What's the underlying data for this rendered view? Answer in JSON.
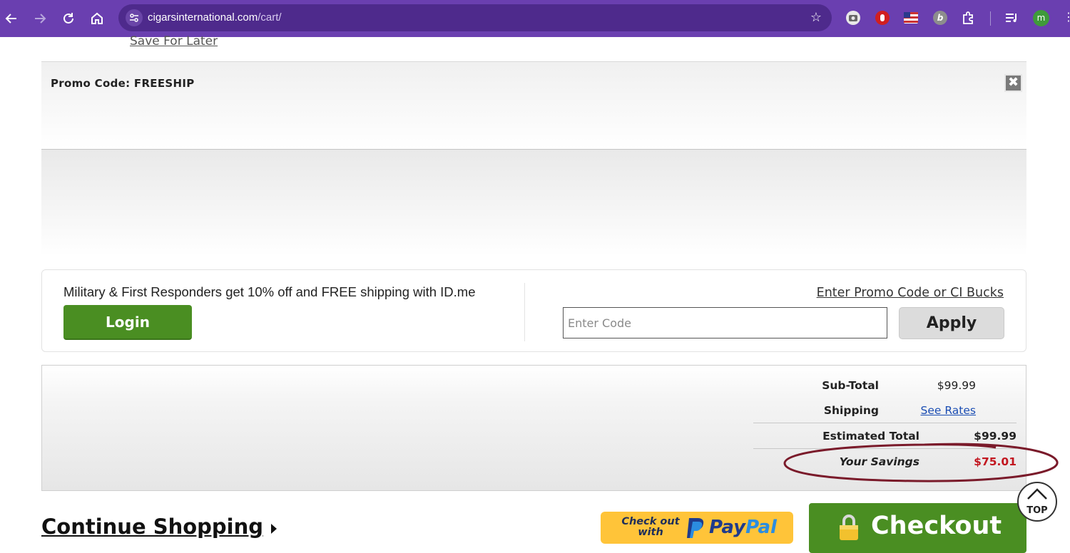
{
  "browser": {
    "url_host": "cigarsinternational.com",
    "url_path": "/cart/",
    "profile_initial": "m"
  },
  "cart": {
    "save_for_later": "Save For Later",
    "promo_banner_label": "Promo Code: FREESHIP",
    "promo_close": "✖"
  },
  "offer": {
    "military_text": "Military & First Responders get 10% off and FREE shipping with ID.me",
    "login_label": "Login",
    "promo_link": "Enter Promo Code or CI Bucks",
    "code_placeholder": "Enter Code",
    "apply_label": "Apply"
  },
  "totals": {
    "subtotal_label": "Sub-Total",
    "subtotal_value": "$99.99",
    "shipping_label": "Shipping",
    "shipping_value": "See Rates",
    "estimated_label": "Estimated Total",
    "estimated_value": "$99.99",
    "savings_label": "Your Savings",
    "savings_value": "$75.01"
  },
  "footer": {
    "continue_label": "Continue Shopping",
    "paypal_small": "Check out with",
    "paypal_pay": "Pay",
    "paypal_pal": "Pal",
    "checkout_label": "Checkout",
    "top_label": "TOP"
  },
  "colors": {
    "chrome": "#6a3fb0",
    "green": "#4a8e22",
    "savings_red": "#c2161f",
    "link_blue": "#1a4db3",
    "paypal_yellow": "#ffc439"
  }
}
